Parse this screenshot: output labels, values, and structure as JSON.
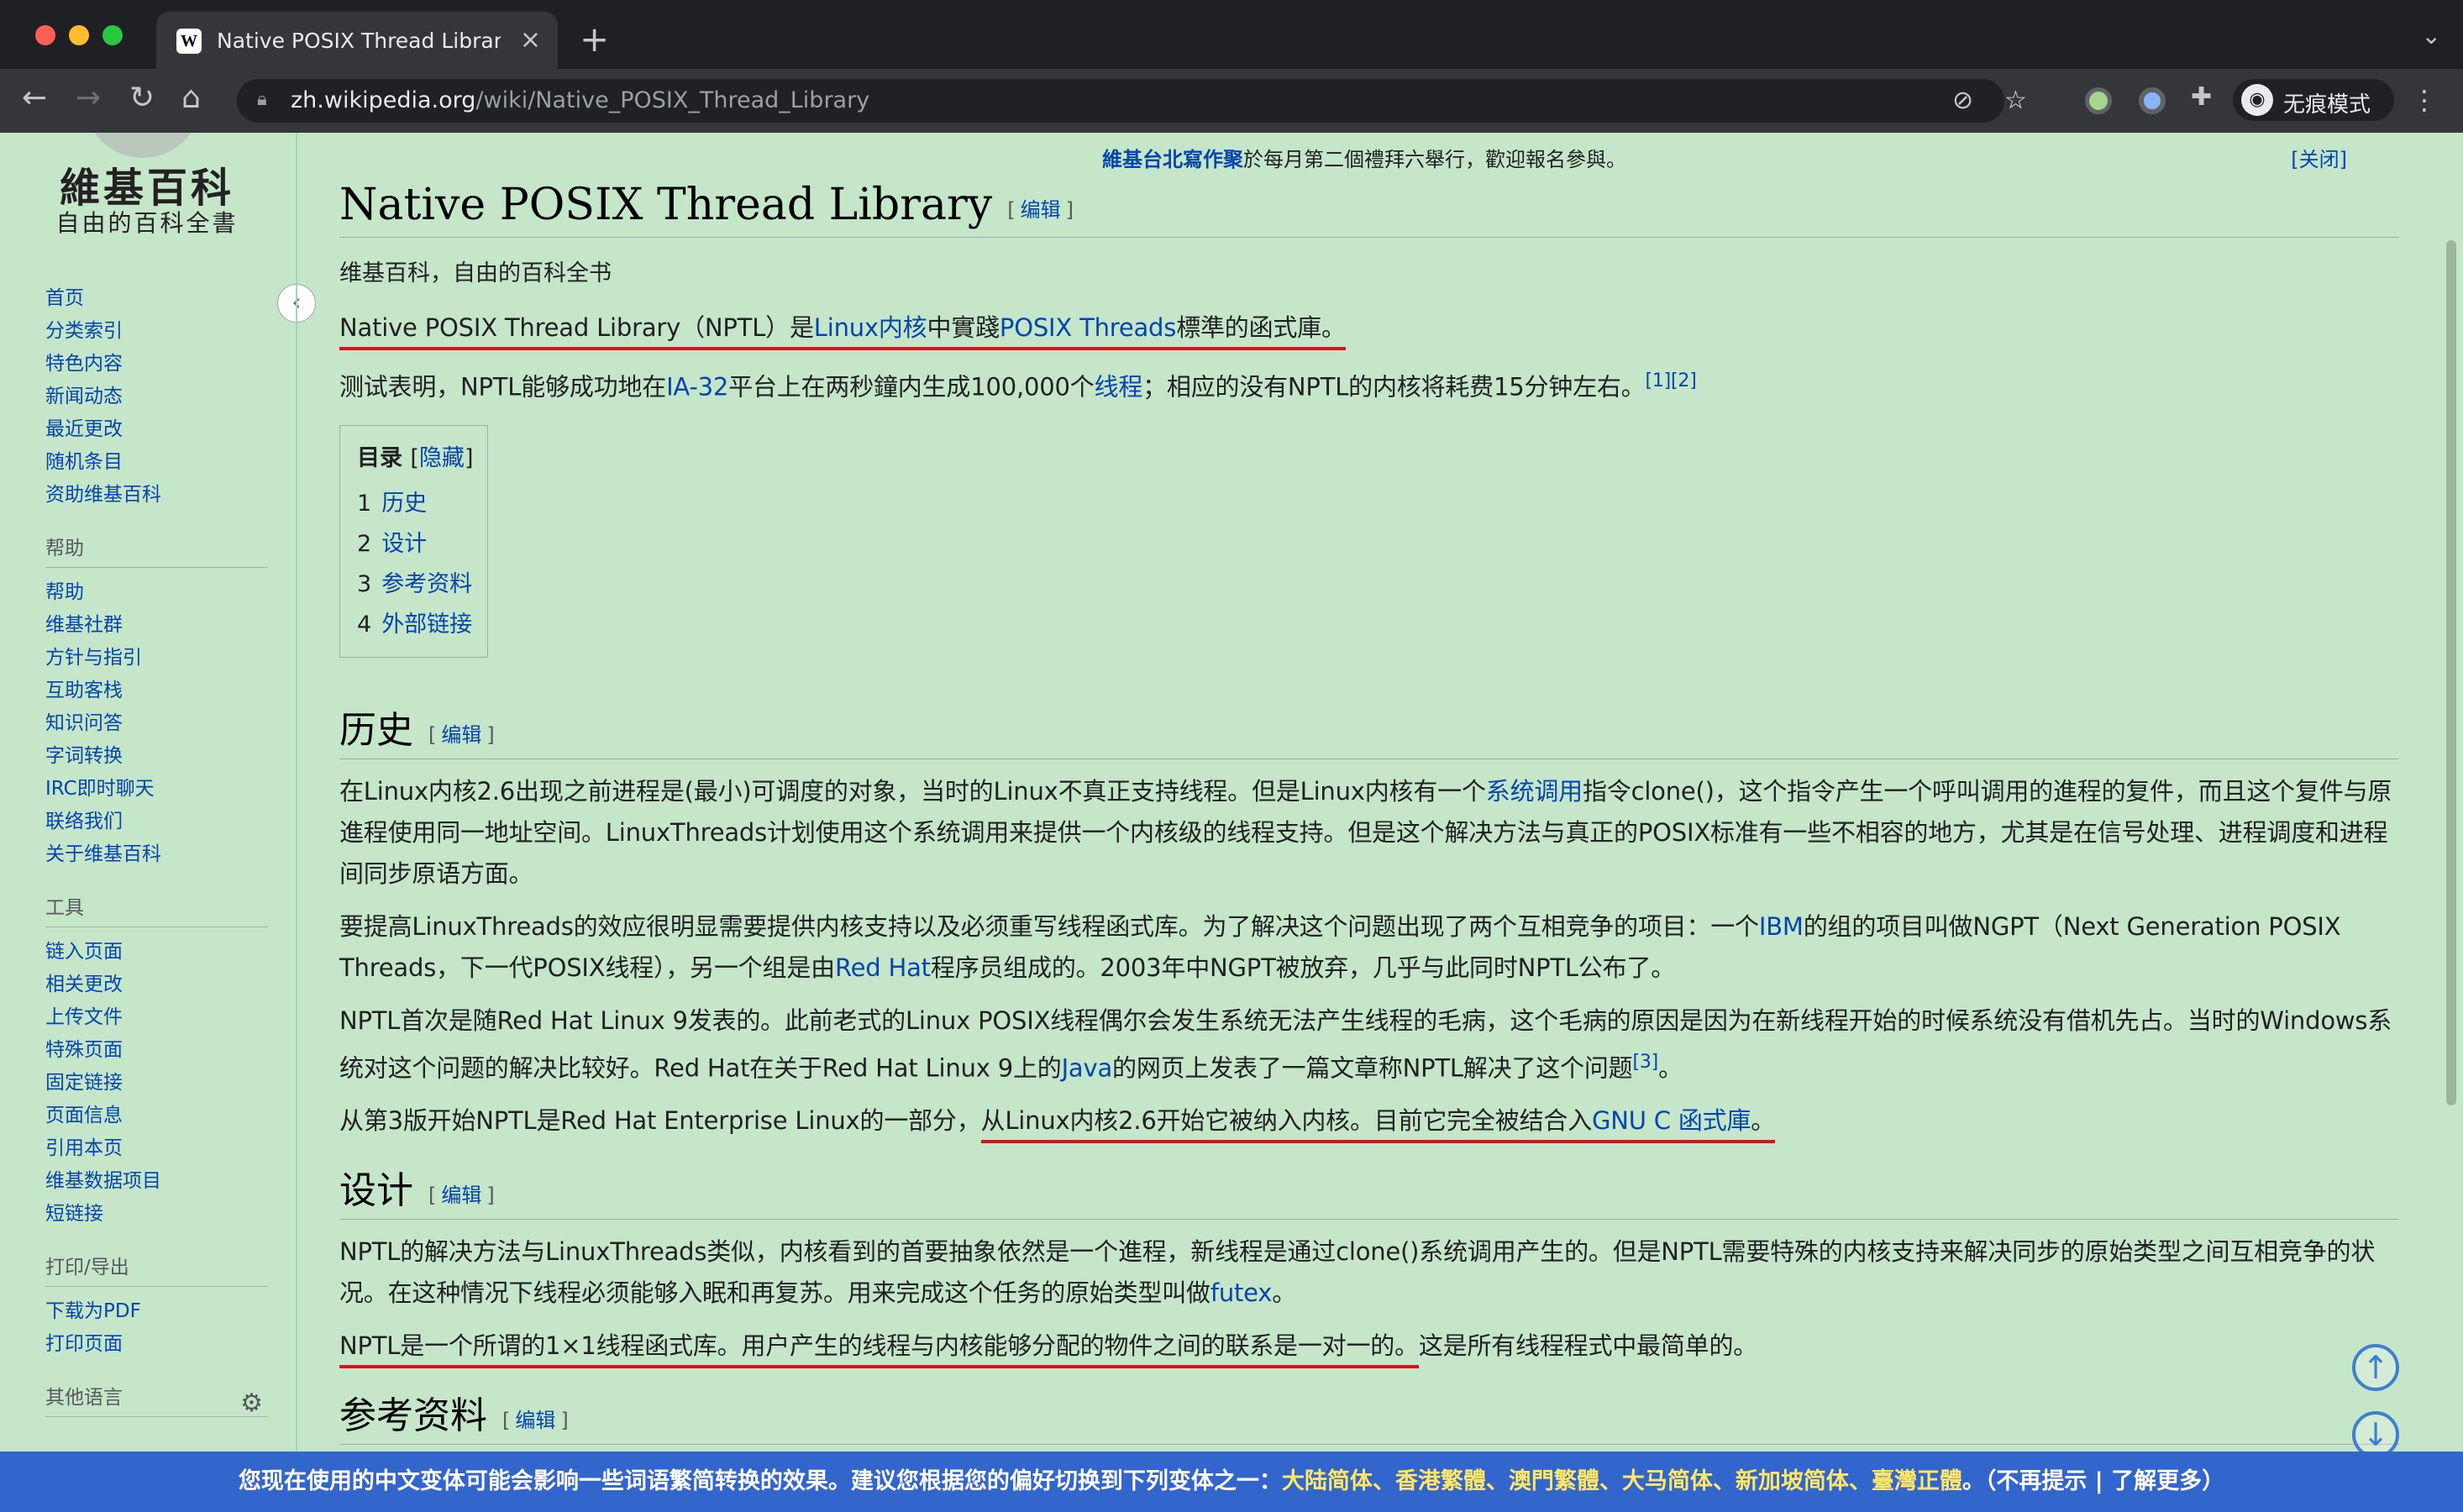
{
  "browser": {
    "tab_title": "Native POSIX Thread Library - ",
    "tab_favicon": "W",
    "url_host": "zh.wikipedia.org",
    "url_path": "/wiki/Native_POSIX_Thread_Library",
    "incognito_label": "无痕模式",
    "icons": [
      "back-icon",
      "forward-icon",
      "reload-icon",
      "home-icon",
      "lock-icon",
      "eye-off-icon",
      "star-icon",
      "puzzle-icon",
      "kebab-icon"
    ]
  },
  "logo": {
    "title": "維基百科",
    "subtitle": "自由的百科全書"
  },
  "sidebar": {
    "nav": [
      "首页",
      "分类索引",
      "特色内容",
      "新闻动态",
      "最近更改",
      "随机条目",
      "资助维基百科"
    ],
    "help_head": "帮助",
    "help": [
      "帮助",
      "维基社群",
      "方针与指引",
      "互助客栈",
      "知识问答",
      "字词转换",
      "IRC即时聊天",
      "联络我们",
      "关于维基百科"
    ],
    "tools_head": "工具",
    "tools": [
      "链入页面",
      "相关更改",
      "上传文件",
      "特殊页面",
      "固定链接",
      "页面信息",
      "引用本页",
      "维基数据项目",
      "短链接"
    ],
    "print_head": "打印/导出",
    "print": [
      "下载为PDF",
      "打印页面"
    ],
    "lang_head": "其他语言"
  },
  "notice": {
    "link": "維基台北寫作聚",
    "text": "於每月第二個禮拜六舉行，歡迎報名參與。",
    "close": "[关闭]"
  },
  "article": {
    "title": "Native POSIX Thread Library",
    "edit": "编辑",
    "tagline": "维基百科，自由的百科全书",
    "lead1": {
      "a": "Native POSIX Thread Library（NPTL）是",
      "l1": "Linux内核",
      "b": "中實踐",
      "l2": "POSIX Threads",
      "c": "標準的函式庫。"
    },
    "lead2": {
      "a": "测试表明，NPTL能够成功地在",
      "l1": "IA-32",
      "b": "平台上在两秒鐘内生成100,000个",
      "l2": "线程",
      "c": "；相应的没有NPTL的内核将耗费15分钟左右。",
      "ref": "[1][2]"
    },
    "toc": {
      "title": "目录",
      "hide": "隐藏",
      "items": [
        {
          "n": "1",
          "t": "历史"
        },
        {
          "n": "2",
          "t": "设计"
        },
        {
          "n": "3",
          "t": "参考资料"
        },
        {
          "n": "4",
          "t": "外部链接"
        }
      ]
    },
    "h_history": "历史",
    "hist1": {
      "a": "在Linux内核2.6出现之前进程是(最小)可调度的对象，当时的Linux不真正支持线程。但是Linux内核有一个",
      "l": "系统调用",
      "b": "指令clone()，这个指令产生一个呼叫调用的進程的复件，而且这个复件与原進程使用同一地址空间。LinuxThreads计划使用这个系统调用来提供一个内核级的线程支持。但是这个解决方法与真正的POSIX标准有一些不相容的地方，尤其是在信号处理、进程调度和进程间同步原语方面。"
    },
    "hist2": {
      "a": "要提高LinuxThreads的效应很明显需要提供内核支持以及必须重写线程函式库。为了解决这个问题出现了两个互相竞争的项目：一个",
      "l1": "IBM",
      "b": "的组的项目叫做NGPT（Next Generation POSIX Threads，下一代POSIX线程），另一个组是由",
      "l2": "Red Hat",
      "c": "程序员组成的。2003年中NGPT被放弃，几乎与此同时NPTL公布了。"
    },
    "hist3": {
      "a": "NPTL首次是随Red Hat Linux 9发表的。此前老式的Linux POSIX线程偶尔会发生系统无法产生线程的毛病，这个毛病的原因是因为在新线程开始的时候系统没有借机先占。当时的Windows系统对这个问题的解决比较好。Red Hat在关于Red Hat Linux 9上的",
      "l": "Java",
      "b": "的网页上发表了一篇文章称NPTL解决了这个问题",
      "ref": "[3]",
      "c": "。"
    },
    "hist4": {
      "a": "从第3版开始NPTL是Red Hat Enterprise Linux的一部分，",
      "u": "从Linux内核2.6开始它被纳入内核。目前它完全被结合入",
      "l": "GNU C 函式庫",
      "c": "。"
    },
    "h_design": "设计",
    "design1": {
      "a": "NPTL的解决方法与LinuxThreads类似，内核看到的首要抽象依然是一个進程，新线程是通过clone()系统调用产生的。但是NPTL需要特殊的内核支持来解决同步的原始类型之间互相竞争的状况。在这种情况下线程必须能够入眠和再复苏。用来完成这个任务的原始类型叫做",
      "l": "futex",
      "b": "。"
    },
    "design2": {
      "u": "NPTL是一个所谓的1×1线程函式库。用户产生的线程与内核能够分配的物件之间的联系是一对一的。",
      "b": "这是所有线程程式中最简单的。"
    },
    "h_refs": "参考资料"
  },
  "bottom": {
    "text": "您现在使用的中文变体可能会影响一些词语繁简转换的效果。建议您根据您的偏好切换到下列变体之一：",
    "variants": "大陆简体、香港繁體、澳門繁體、大马简体、新加坡简体、臺灣正體",
    "tail": "。（不再提示 | 了解更多）"
  }
}
